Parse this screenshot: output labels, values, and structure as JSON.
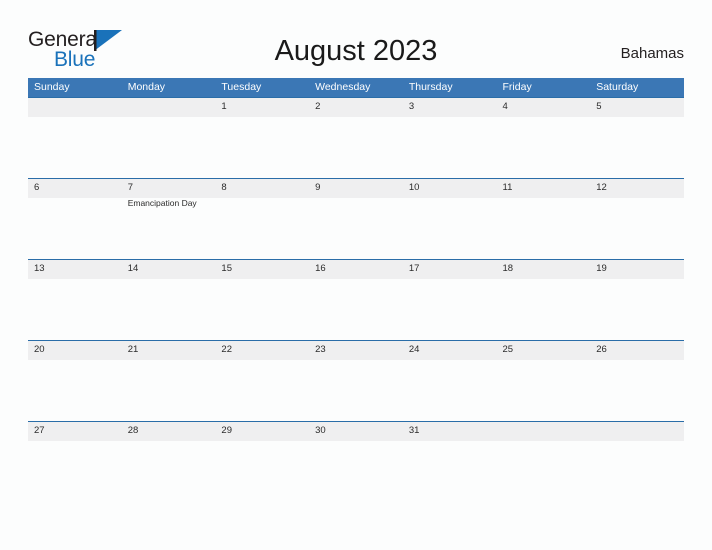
{
  "brand": {
    "name_part1": "General",
    "name_part2": "Blue",
    "triangle_icon": "blue-triangle-logo-mark",
    "color_primary": "#1a72ba",
    "color_text": "#231f20"
  },
  "header": {
    "title": "August 2023",
    "country": "Bahamas"
  },
  "calendar": {
    "month": "August",
    "year": "2023",
    "header_bg": "#3b77b5",
    "band_bg": "#efeff0",
    "rule_color": "#2a6da8",
    "weekdays": [
      "Sunday",
      "Monday",
      "Tuesday",
      "Wednesday",
      "Thursday",
      "Friday",
      "Saturday"
    ],
    "weeks": [
      [
        {
          "day": ""
        },
        {
          "day": ""
        },
        {
          "day": "1"
        },
        {
          "day": "2"
        },
        {
          "day": "3"
        },
        {
          "day": "4"
        },
        {
          "day": "5"
        }
      ],
      [
        {
          "day": "6"
        },
        {
          "day": "7",
          "event": "Emancipation Day"
        },
        {
          "day": "8"
        },
        {
          "day": "9"
        },
        {
          "day": "10"
        },
        {
          "day": "11"
        },
        {
          "day": "12"
        }
      ],
      [
        {
          "day": "13"
        },
        {
          "day": "14"
        },
        {
          "day": "15"
        },
        {
          "day": "16"
        },
        {
          "day": "17"
        },
        {
          "day": "18"
        },
        {
          "day": "19"
        }
      ],
      [
        {
          "day": "20"
        },
        {
          "day": "21"
        },
        {
          "day": "22"
        },
        {
          "day": "23"
        },
        {
          "day": "24"
        },
        {
          "day": "25"
        },
        {
          "day": "26"
        }
      ],
      [
        {
          "day": "27"
        },
        {
          "day": "28"
        },
        {
          "day": "29"
        },
        {
          "day": "30"
        },
        {
          "day": "31"
        },
        {
          "day": ""
        },
        {
          "day": ""
        }
      ]
    ]
  }
}
